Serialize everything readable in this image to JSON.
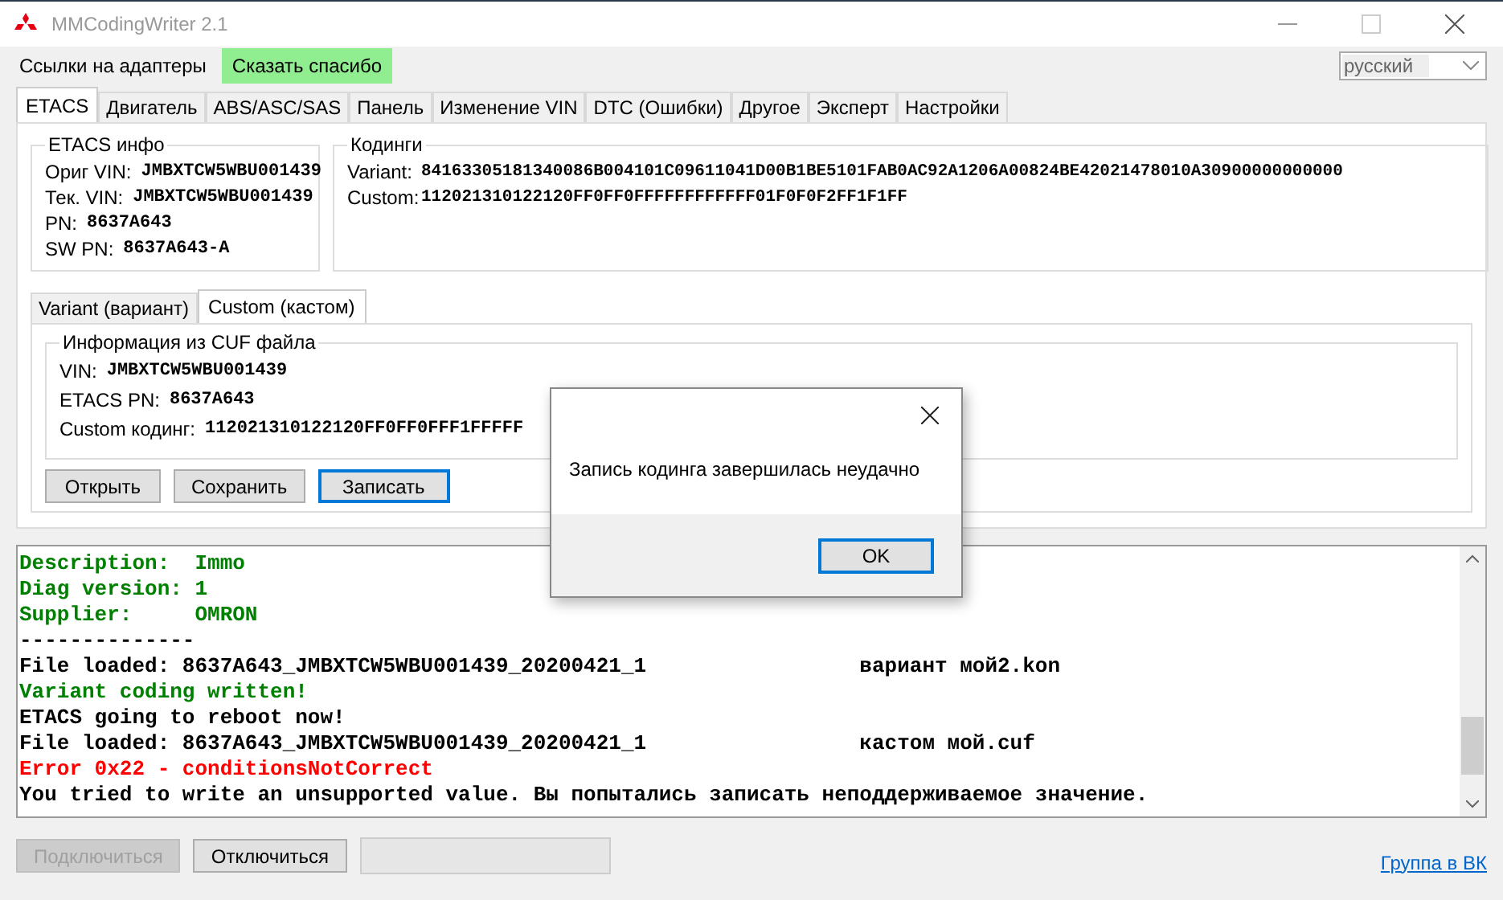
{
  "window": {
    "title": "MMCodingWriter 2.1"
  },
  "menu": [
    {
      "label": "Ссылки на адаптеры",
      "highlighted": false
    },
    {
      "label": "Сказать спасибо",
      "highlighted": true
    }
  ],
  "language": {
    "value": "русский"
  },
  "tabs": [
    {
      "label": "ETACS",
      "selected": true
    },
    {
      "label": "Двигатель",
      "selected": false
    },
    {
      "label": "ABS/ASC/SAS",
      "selected": false
    },
    {
      "label": "Панель",
      "selected": false
    },
    {
      "label": "Изменение VIN",
      "selected": false
    },
    {
      "label": "DTC (Ошибки)",
      "selected": false
    },
    {
      "label": "Другое",
      "selected": false
    },
    {
      "label": "Эксперт",
      "selected": false
    },
    {
      "label": "Настройки",
      "selected": false
    }
  ],
  "etacs_info": {
    "title": "ETACS инфо",
    "fields": [
      {
        "label": "Ориг VIN:",
        "value": "JMBXTCW5WBU001439"
      },
      {
        "label": "Тек. VIN:",
        "value": "JMBXTCW5WBU001439"
      },
      {
        "label": "PN:",
        "value": "8637A643"
      },
      {
        "label": "SW PN:",
        "value": "8637A643-A"
      }
    ]
  },
  "codings": {
    "title": "Кодинги",
    "fields": [
      {
        "label": "Variant:",
        "value": "84163305181340086B004101C09611041D00B1BE5101FAB0AC92A1206A00824BE42021478010A30900000000000"
      },
      {
        "label": "Custom:",
        "value": "112021310122120FF0FF0FFFFFFFFFFFF01F0F0F2FF1F1FF"
      }
    ]
  },
  "sub_tabs": [
    {
      "label": "Variant (вариант)",
      "selected": false
    },
    {
      "label": "Custom (кастом)",
      "selected": true
    }
  ],
  "cuf_info": {
    "title": "Информация из CUF файла",
    "fields": [
      {
        "label": "VIN:",
        "value": "JMBXTCW5WBU001439"
      },
      {
        "label": "ETACS PN:",
        "value": "8637A643"
      },
      {
        "label": "Custom кодинг:",
        "value": "112021310122120FF0FF0FFF1FFFFF"
      }
    ]
  },
  "buttons": [
    {
      "label": "Открыть",
      "focused": false
    },
    {
      "label": "Сохранить",
      "focused": false
    },
    {
      "label": "Записать",
      "focused": true
    }
  ],
  "log": [
    {
      "text": "Description:  Immo",
      "color": "#008000"
    },
    {
      "text": "Diag version: 1",
      "color": "#008000"
    },
    {
      "text": "Supplier:     OMRON",
      "color": "#008000"
    },
    {
      "text": "--------------",
      "color": "#000000"
    },
    {
      "text": "File loaded: 8637A643_JMBXTCW5WBU001439_20200421_1                 вариант мой2.kon",
      "color": "#000000"
    },
    {
      "text": "Variant coding written!",
      "color": "#008000"
    },
    {
      "text": "ETACS going to reboot now!",
      "color": "#000000"
    },
    {
      "text": "File loaded: 8637A643_JMBXTCW5WBU001439_20200421_1                 кастом мой.cuf",
      "color": "#000000"
    },
    {
      "text": "Error 0x22 - conditionsNotCorrect",
      "color": "#ff0000"
    },
    {
      "text": "You tried to write an unsupported value. Вы попытались записать неподдерживаемое значение.",
      "color": "#000000"
    }
  ],
  "bottom_buttons": [
    {
      "label": "Подключиться",
      "disabled": true
    },
    {
      "label": "Отключиться",
      "disabled": false
    }
  ],
  "link": "Группа в ВК",
  "dialog": {
    "message": "Запись кодинга завершилась неудачно",
    "button": "OK"
  }
}
